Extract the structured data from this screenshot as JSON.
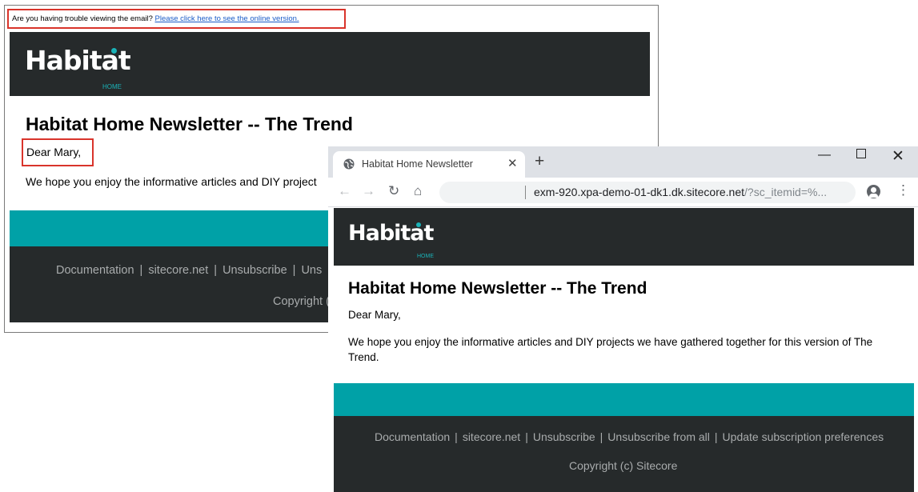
{
  "email": {
    "trouble_text": "Are you having trouble viewing the email?",
    "online_link": "Please click here to see the online version.",
    "logo_text": "Habitat",
    "logo_sub": "HOME",
    "title": "Habitat Home Newsletter -- The Trend",
    "greeting": "Dear Mary,",
    "body": "We hope you enjoy the informative articles and DIY project",
    "footer": {
      "links": [
        "Documentation",
        "sitecore.net",
        "Unsubscribe",
        "Uns"
      ],
      "copyright": "Copyright ("
    }
  },
  "browser": {
    "tab_title": "Habitat Home Newsletter",
    "url_host": "exm-920.xpa-demo-01-dk1.dk.sitecore.net",
    "url_rest": "/?sc_itemid=%...",
    "icons": [
      "globe-icon",
      "close-icon",
      "plus-icon",
      "minimize-icon",
      "maximize-icon",
      "back-arrow-icon",
      "forward-arrow-icon",
      "reload-icon",
      "home-icon",
      "star-icon",
      "profile-icon",
      "kebab-menu-icon"
    ]
  },
  "page": {
    "logo_text": "Habitat",
    "logo_sub": "HOME",
    "title": "Habitat Home Newsletter -- The Trend",
    "greeting": "Dear Mary,",
    "body": "We hope you enjoy the informative articles and DIY projects we have gathered together for this version of The Trend.",
    "footer": {
      "links": [
        "Documentation",
        "sitecore.net",
        "Unsubscribe",
        "Unsubscribe from all",
        "Update subscription preferences"
      ],
      "copyright": "Copyright (c) Sitecore"
    }
  },
  "colors": {
    "dark": "#262a2b",
    "teal": "#00a1a7",
    "highlight": "#d9342b",
    "link": "#1a5cc8"
  }
}
